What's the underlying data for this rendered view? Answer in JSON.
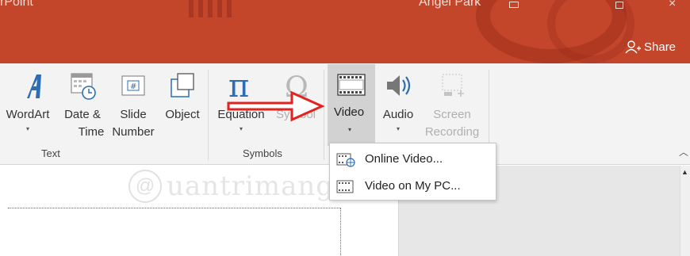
{
  "titlebar": {
    "app_title": "rPoint",
    "user_name": "Angel Park",
    "share_label": "Share",
    "color": "#c3452a"
  },
  "ribbon": {
    "text_group": {
      "label": "Text",
      "buttons": {
        "wordart": "WordArt",
        "datetime_1": "Date &",
        "datetime_2": "Time",
        "slidenum_1": "Slide",
        "slidenum_2": "Number",
        "object": "Object"
      }
    },
    "symbols_group": {
      "label": "Symbols",
      "equation": "Equation",
      "symbol": "Symbol"
    },
    "media_group": {
      "video": "Video",
      "audio": "Audio",
      "screen_recording_1": "Screen",
      "screen_recording_2": "Recording"
    },
    "dropdown_arrow": "▾",
    "collapse_icon": "chevron-up-icon"
  },
  "video_menu": {
    "items": [
      {
        "label": "Online Video...",
        "icon": "online-video-icon"
      },
      {
        "label": "Video on My PC...",
        "icon": "film-strip-icon"
      }
    ]
  },
  "watermark": {
    "text": "uantrimang",
    "icon": "@"
  }
}
